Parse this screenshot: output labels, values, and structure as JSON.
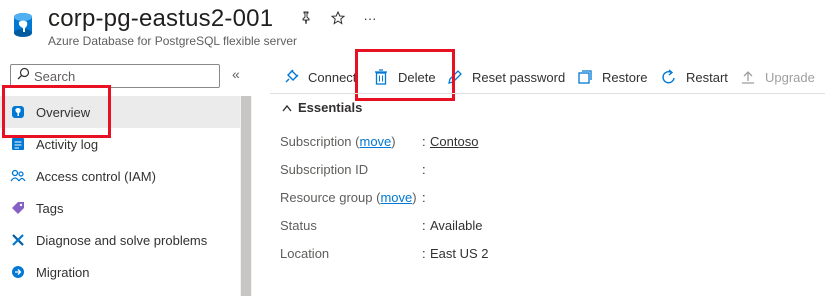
{
  "header": {
    "title": "corp-pg-eastus2-001",
    "subtitle": "Azure Database for PostgreSQL flexible server",
    "pin_icon": "pin-icon",
    "favorite_icon": "star-icon",
    "more_label": "···"
  },
  "sidebar": {
    "search_placeholder": "Search",
    "collapse_label": "«",
    "items": [
      {
        "label": "Overview",
        "icon": "postgresql-icon"
      },
      {
        "label": "Activity log",
        "icon": "activity-log-icon"
      },
      {
        "label": "Access control (IAM)",
        "icon": "people-icon"
      },
      {
        "label": "Tags",
        "icon": "tag-icon"
      },
      {
        "label": "Diagnose and solve problems",
        "icon": "wrench-icon"
      },
      {
        "label": "Migration",
        "icon": "migration-icon"
      }
    ]
  },
  "commands": [
    {
      "label": "Connect",
      "icon": "plug-icon",
      "enabled": true
    },
    {
      "label": "Delete",
      "icon": "trash-icon",
      "enabled": true
    },
    {
      "label": "Reset password",
      "icon": "pencil-icon",
      "enabled": true
    },
    {
      "label": "Restore",
      "icon": "restore-icon",
      "enabled": true
    },
    {
      "label": "Restart",
      "icon": "refresh-icon",
      "enabled": true
    },
    {
      "label": "Upgrade",
      "icon": "upgrade-icon",
      "enabled": false
    }
  ],
  "essentials": {
    "heading": "Essentials",
    "move_link": "move",
    "rows": [
      {
        "label": "Subscription",
        "has_move": true,
        "value": "Contoso",
        "value_is_link": true
      },
      {
        "label": "Subscription ID",
        "has_move": false,
        "value": ""
      },
      {
        "label": "Resource group",
        "has_move": true,
        "value": ""
      },
      {
        "label": "Status",
        "has_move": false,
        "value": "Available"
      },
      {
        "label": "Location",
        "has_move": false,
        "value": "East US 2"
      }
    ]
  },
  "colors": {
    "accent": "#0078d4",
    "highlight_box": "#e81123",
    "active_nav": "#ebebeb"
  }
}
